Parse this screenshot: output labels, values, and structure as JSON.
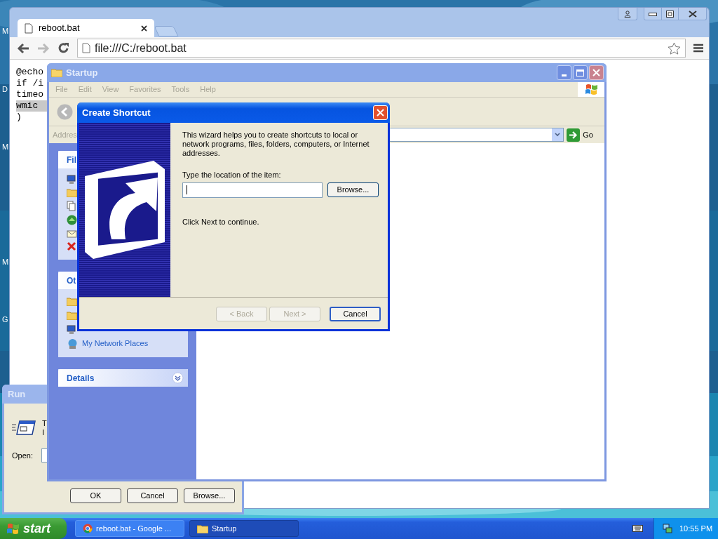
{
  "desktop": {
    "icon_labels": [
      "M",
      "D",
      "M",
      "M",
      "G"
    ]
  },
  "browser": {
    "tabs": [
      {
        "title": "reboot.bat",
        "selected": true
      }
    ],
    "url": "file:///C:/reboot.bat",
    "code_lines": [
      {
        "text": "@echo",
        "selected": false
      },
      {
        "text": "if /i",
        "selected": false
      },
      {
        "text": "timeo",
        "selected": false
      },
      {
        "text": "wmic",
        "selected": true
      },
      {
        "text": ")",
        "selected": false
      }
    ]
  },
  "run_dialog": {
    "title": "Run",
    "description_lines": [
      "T",
      "I"
    ],
    "open_label": "Open:",
    "buttons": [
      "OK",
      "Cancel",
      "Browse..."
    ]
  },
  "explorer": {
    "title": "Startup",
    "active": false,
    "menu": [
      "File",
      "Edit",
      "View",
      "Favorites",
      "Tools",
      "Help"
    ],
    "address_label": "Addres",
    "go_label": "Go",
    "panels": [
      {
        "title": "Fil"
      },
      {
        "title": "Ot",
        "items": [
          "My Network Places"
        ]
      },
      {
        "title": "Details"
      }
    ]
  },
  "dialog": {
    "title": "Create Shortcut",
    "intro": "This wizard helps you to create shortcuts to local or network programs, files, folders, computers, or Internet addresses.",
    "location_label": "Type the location of the item:",
    "browse_label": "Browse...",
    "hint": "Click Next to continue.",
    "buttons": [
      {
        "label": "< Back",
        "disabled": true
      },
      {
        "label": "Next >",
        "disabled": true
      },
      {
        "label": "Cancel",
        "disabled": false
      }
    ]
  },
  "taskbar": {
    "start_label": "start",
    "tasks": [
      {
        "label": "reboot.bat - Google ...",
        "kind": "browser",
        "selected": false
      },
      {
        "label": "Startup",
        "kind": "folder",
        "selected": true
      }
    ],
    "clock": "10:55 PM"
  }
}
